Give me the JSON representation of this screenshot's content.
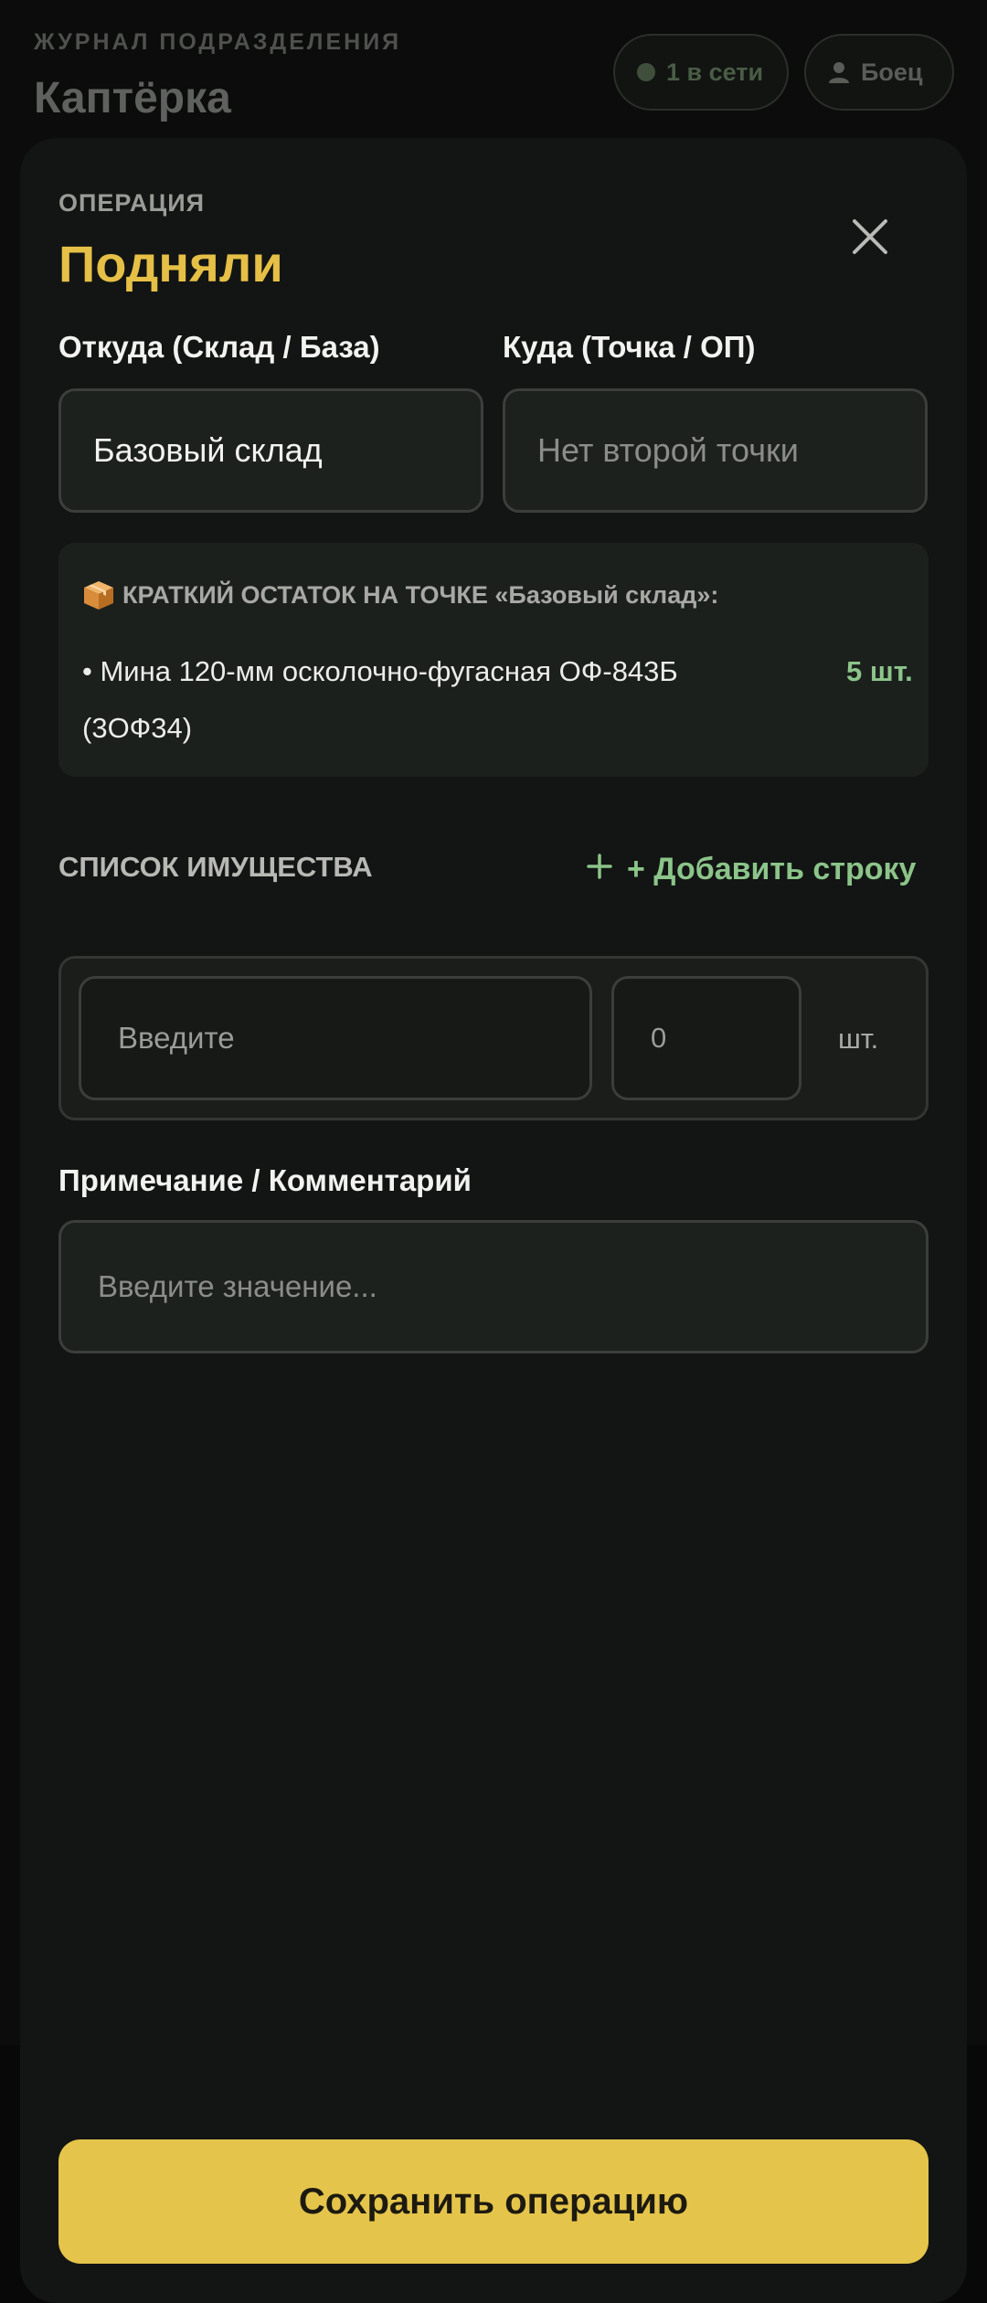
{
  "background": {
    "subtitle": "ЖУРНАЛ ПОДРАЗДЕЛЕНИЯ",
    "title": "Каптёрка",
    "online_label": "1 в сети",
    "user_label": "Боец"
  },
  "sheet": {
    "operation_label": "ОПЕРАЦИЯ",
    "operation_title": "Подняли",
    "from_label": "Откуда (Склад / База)",
    "from_value": "Базовый склад",
    "to_label": "Куда (Точка / ОП)",
    "to_placeholder": "Нет второй точки",
    "stock": {
      "heading": "КРАТКИЙ ОСТАТОК НА ТОЧКЕ «Базовый склад»:",
      "items": [
        {
          "name": "• Мина 120-мм осколочно-фугасная ОФ-843Б (3ОФ34)",
          "qty": "5 шт."
        }
      ]
    },
    "list_label": "СПИСОК ИМУЩЕСТВА",
    "add_row_label": "+ Добавить строку",
    "row": {
      "name_placeholder": "Введите",
      "qty_placeholder": "0",
      "unit": "шт."
    },
    "note_label": "Примечание / Комментарий",
    "note_placeholder": "Введите значение...",
    "save_label": "Сохранить операцию"
  },
  "colors": {
    "accent": "#e4c44a",
    "title": "#e6bf46",
    "positive": "#8cc48a",
    "sheet_bg": "#121513"
  },
  "icons": {
    "close": "close-icon",
    "add": "plus-icon",
    "stock": "package-icon",
    "online": "status-dot-icon",
    "user": "user-icon"
  }
}
